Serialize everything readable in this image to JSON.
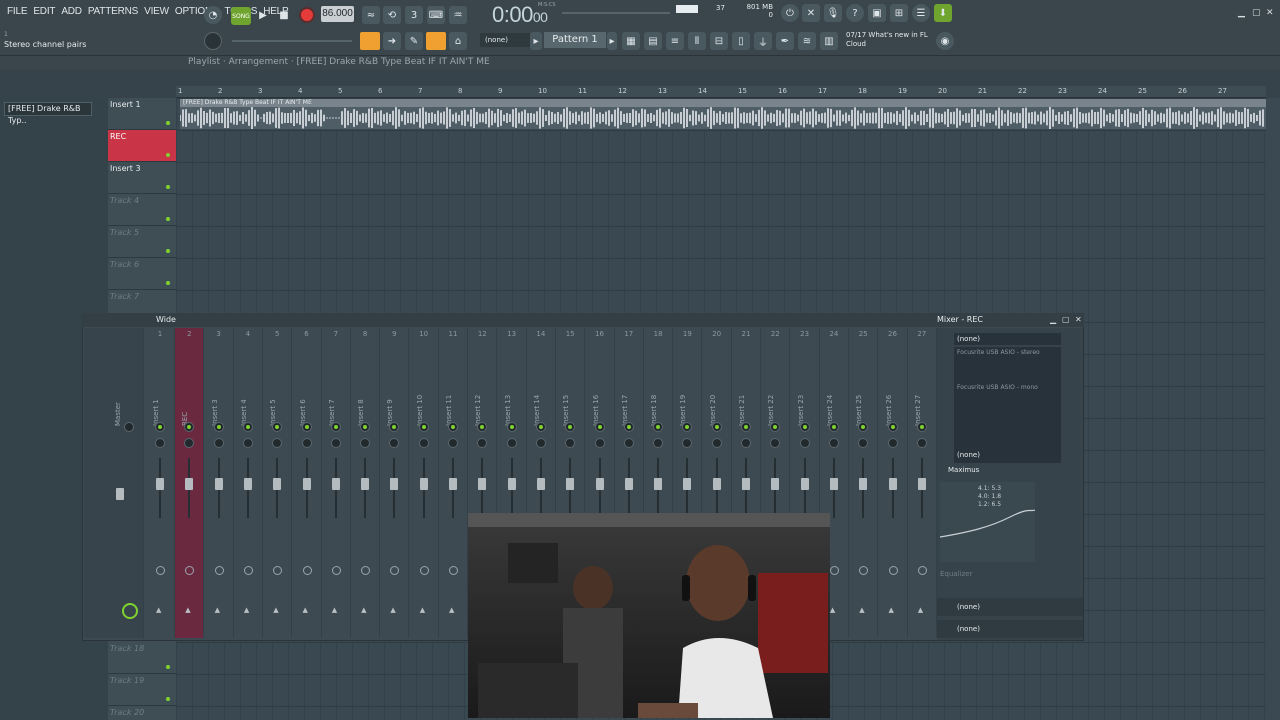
{
  "menu": [
    "FILE",
    "EDIT",
    "ADD",
    "PATTERNS",
    "VIEW",
    "OPTIONS",
    "TOOLS",
    "HELP"
  ],
  "hint": {
    "top": "1",
    "text": "Stereo channel pairs"
  },
  "transport": {
    "mode": "SONG",
    "tempo": "86.000",
    "time": "0:00",
    "time_frac": "00",
    "time_label": "M:S:CS"
  },
  "cpu": {
    "value": "37"
  },
  "memory": {
    "value": "801 MB",
    "sub": "0"
  },
  "pattern": {
    "selector": "Pattern 1",
    "none": "(none)"
  },
  "news": {
    "date": "07/17",
    "text": "What's new in FL",
    "text2": "Cloud"
  },
  "playlist": {
    "breadcrumb": "Playlist · Arrangement · [FREE] Drake R&B Type Beat IF IT AIN'T ME",
    "pattern_item": "[FREE] Drake R&B Typ..",
    "clip_label": "[FREE] Drake R&B Type Beat IF IT AIN'T ME",
    "ruler": [
      "1",
      "2",
      "3",
      "4",
      "5",
      "6",
      "7",
      "8",
      "9",
      "10",
      "11",
      "12",
      "13",
      "14",
      "15",
      "16",
      "17",
      "18",
      "19",
      "20",
      "21",
      "22",
      "23",
      "24",
      "25",
      "26",
      "27"
    ],
    "tracks": [
      {
        "name": "Insert 1",
        "style": "normal"
      },
      {
        "name": "REC",
        "style": "rec"
      },
      {
        "name": "Insert 3",
        "style": "normal"
      },
      {
        "name": "Track 4",
        "style": "dim"
      },
      {
        "name": "Track 5",
        "style": "dim"
      },
      {
        "name": "Track 6",
        "style": "dim"
      },
      {
        "name": "Track 7",
        "style": "dim"
      }
    ],
    "tracks_bottom": [
      {
        "name": "Track 18",
        "style": "dim"
      },
      {
        "name": "Track 19",
        "style": "dim"
      },
      {
        "name": "Track 20",
        "style": "dim"
      }
    ]
  },
  "mixer": {
    "title": "Mixer - REC",
    "view": "Wide",
    "master_label": "Master",
    "strips": [
      {
        "num": "1",
        "name": "Insert 1"
      },
      {
        "num": "2",
        "name": "REC"
      },
      {
        "num": "3",
        "name": "Insert 3"
      },
      {
        "num": "4",
        "name": "Insert 4"
      },
      {
        "num": "5",
        "name": "Insert 5"
      },
      {
        "num": "6",
        "name": "Insert 6"
      },
      {
        "num": "7",
        "name": "Insert 7"
      },
      {
        "num": "8",
        "name": "Insert 8"
      },
      {
        "num": "9",
        "name": "Insert 9"
      },
      {
        "num": "10",
        "name": "Insert 10"
      },
      {
        "num": "11",
        "name": "Insert 11"
      },
      {
        "num": "12",
        "name": "Insert 12"
      },
      {
        "num": "13",
        "name": "Insert 13"
      },
      {
        "num": "14",
        "name": "Insert 14"
      },
      {
        "num": "15",
        "name": "Insert 15"
      },
      {
        "num": "16",
        "name": "Insert 16"
      },
      {
        "num": "17",
        "name": "Insert 17"
      },
      {
        "num": "18",
        "name": "Insert 18"
      },
      {
        "num": "19",
        "name": "Insert 19"
      },
      {
        "num": "20",
        "name": "Insert 20"
      },
      {
        "num": "21",
        "name": "Insert 21"
      },
      {
        "num": "22",
        "name": "Insert 22"
      },
      {
        "num": "23",
        "name": "Insert 23"
      },
      {
        "num": "24",
        "name": "Insert 24"
      },
      {
        "num": "25",
        "name": "Insert 25"
      },
      {
        "num": "26",
        "name": "Insert 26"
      },
      {
        "num": "27",
        "name": "Insert 27"
      }
    ],
    "input": "(none)",
    "inputs_list": [
      "Focusrite USB ASIO - stereo",
      "Focusrite USB ASIO - mono"
    ],
    "slot_none": "(none)",
    "plugin": "Maximus",
    "eq_label": "Equalizer",
    "eq_values": [
      "4.1: 5.3",
      "4.0: 1.8",
      "1.2: 6.5"
    ],
    "out_none1": "(none)",
    "out_none2": "(none)"
  },
  "colors": {
    "rec": "#c93447",
    "accent_green": "#7fd22f",
    "accent_orange": "#f0a030"
  }
}
